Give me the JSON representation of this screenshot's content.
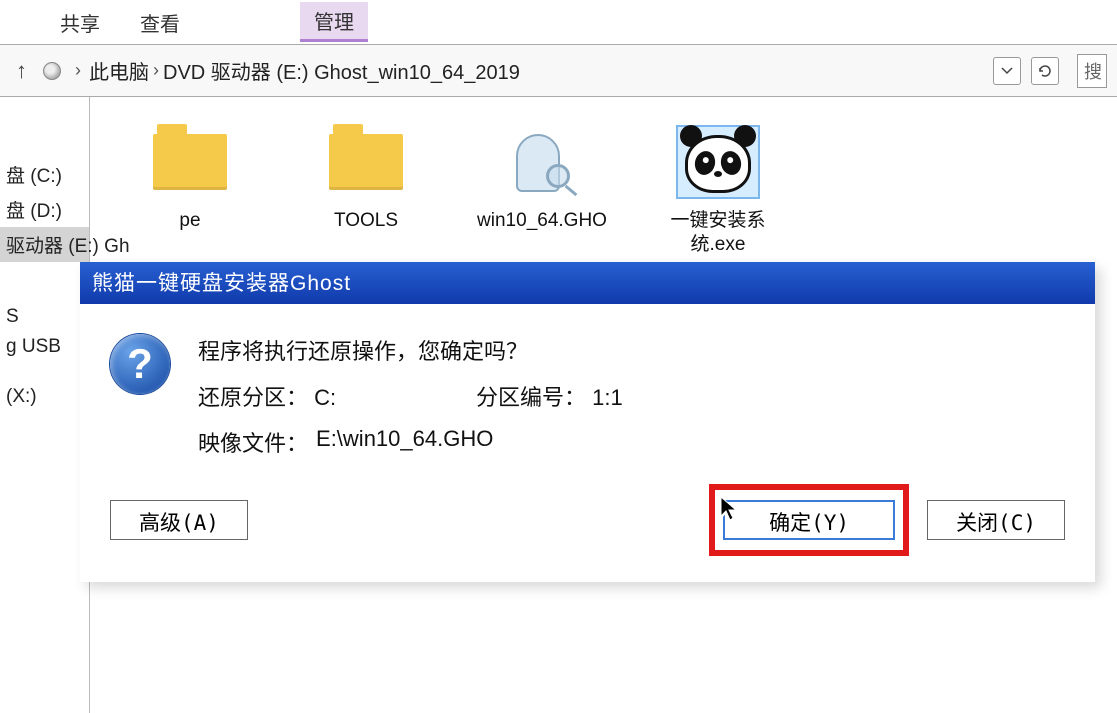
{
  "ribbon": {
    "share": "共享",
    "view": "查看",
    "manage": "管理"
  },
  "breadcrumb": {
    "this_pc": "此电脑",
    "drive": "DVD 驱动器 (E:) Ghost_win10_64_2019"
  },
  "search": {
    "placeholder": "搜"
  },
  "sidebar": {
    "c": "盘 (C:)",
    "d": "盘 (D:)",
    "e": "驱动器 (E:) Gh",
    "s": "S",
    "usb": "g USB",
    "x": "(X:)"
  },
  "files": {
    "pe": "pe",
    "tools": "TOOLS",
    "gho": "win10_64.GHO",
    "exe": "一键安装系统.exe"
  },
  "dialog": {
    "title": "熊猫一键硬盘安装器Ghost",
    "question": "程序将执行还原操作，您确定吗？",
    "partition_label": "还原分区：",
    "partition_value": "C:",
    "partnum_label": "分区编号：",
    "partnum_value": "1:1",
    "image_label": "映像文件：",
    "image_value": "E:\\win10_64.GHO",
    "advanced": "高级(A)",
    "ok": "确定(Y)",
    "close": "关闭(C)"
  }
}
